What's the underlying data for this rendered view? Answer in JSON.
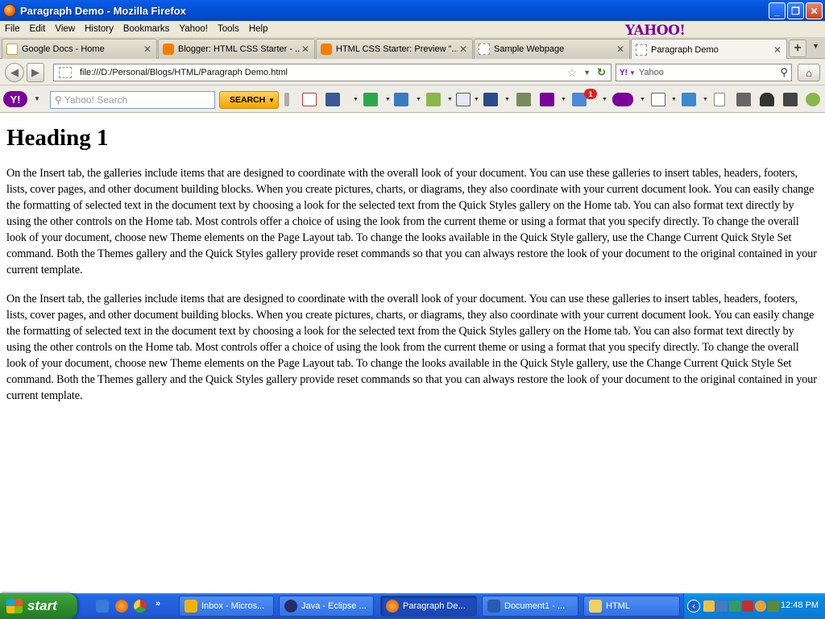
{
  "window": {
    "title": "Paragraph Demo - Mozilla Firefox"
  },
  "menu": [
    "File",
    "Edit",
    "View",
    "History",
    "Bookmarks",
    "Yahoo!",
    "Tools",
    "Help"
  ],
  "menu_logo": "YAHOO!",
  "tabs": [
    {
      "label": "Google Docs - Home",
      "icon": "google-docs-icon"
    },
    {
      "label": "Blogger: HTML CSS Starter - ...",
      "icon": "blogger-icon"
    },
    {
      "label": "HTML CSS Starter: Preview \"...",
      "icon": "blogger-icon"
    },
    {
      "label": "Sample Webpage",
      "icon": "blank-page-icon"
    },
    {
      "label": "Paragraph Demo",
      "icon": "blank-page-icon",
      "active": true
    }
  ],
  "nav": {
    "url": "file:///D:/Personal/Blogs/HTML/Paragraph Demo.html",
    "search_engine_value": "Yahoo"
  },
  "yahoo_toolbar": {
    "search_placeholder": "Yahoo! Search",
    "search_button": "SEARCH",
    "mail_badge": "1"
  },
  "page": {
    "heading": "Heading 1",
    "paragraphs": [
      "On the Insert tab, the galleries include items that are designed to coordinate with the overall look of your document. You can use these galleries to insert tables, headers, footers, lists, cover pages, and other document building blocks. When you create pictures, charts, or diagrams, they also coordinate with your current document look. You can easily change the formatting of selected text in the document text by choosing a look for the selected text from the Quick Styles gallery on the Home tab. You can also format text directly by using the other controls on the Home tab. Most controls offer a choice of using the look from the current theme or using a format that you specify directly. To change the overall look of your document, choose new Theme elements on the Page Layout tab. To change the looks available in the Quick Style gallery, use the Change Current Quick Style Set command. Both the Themes gallery and the Quick Styles gallery provide reset commands so that you can always restore the look of your document to the original contained in your current template.",
      "On the Insert tab, the galleries include items that are designed to coordinate with the overall look of your document. You can use these galleries to insert tables, headers, footers, lists, cover pages, and other document building blocks. When you create pictures, charts, or diagrams, they also coordinate with your current document look. You can easily change the formatting of selected text in the document text by choosing a look for the selected text from the Quick Styles gallery on the Home tab. You can also format text directly by using the other controls on the Home tab. Most controls offer a choice of using the look from the current theme or using a format that you specify directly. To change the overall look of your document, choose new Theme elements on the Page Layout tab. To change the looks available in the Quick Style gallery, use the Change Current Quick Style Set command. Both the Themes gallery and the Quick Styles gallery provide reset commands so that you can always restore the look of your document to the original contained in your current template."
    ]
  },
  "taskbar": {
    "start_label": "start",
    "buttons": [
      {
        "label": "Inbox - Micros...",
        "icon": "outlook-icon"
      },
      {
        "label": "Java - Eclipse ...",
        "icon": "eclipse-icon"
      },
      {
        "label": "Paragraph De...",
        "icon": "firefox-icon",
        "active": true
      },
      {
        "label": "Document1 - ...",
        "icon": "word-icon"
      },
      {
        "label": "HTML",
        "icon": "folder-icon"
      }
    ],
    "clock": "12:48 PM"
  },
  "colors": {
    "title_bar": "#0350d8",
    "yahoo_purple": "#7b0099",
    "taskbar": "#2259d6",
    "start_green": "#2e8f2e"
  }
}
